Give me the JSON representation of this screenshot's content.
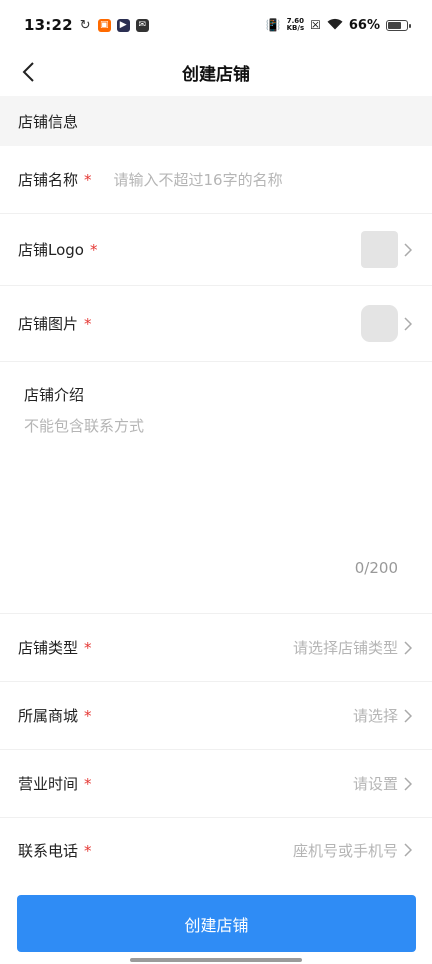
{
  "status": {
    "time": "13:22",
    "net_speed_top": "7.60",
    "net_speed_bottom": "KB/s",
    "battery": "66%",
    "battery_level": 0.66
  },
  "nav": {
    "title": "创建店铺"
  },
  "section": {
    "title": "店铺信息"
  },
  "form": {
    "required_mark": "*",
    "name": {
      "label": "店铺名称",
      "placeholder": "请输入不超过16字的名称",
      "value": ""
    },
    "logo": {
      "label": "店铺Logo"
    },
    "image": {
      "label": "店铺图片"
    },
    "intro": {
      "label": "店铺介绍",
      "placeholder": "不能包含联系方式",
      "counter": "0/200"
    },
    "type": {
      "label": "店铺类型",
      "placeholder": "请选择店铺类型"
    },
    "mall": {
      "label": "所属商城",
      "placeholder": "请选择"
    },
    "hours": {
      "label": "营业时间",
      "placeholder": "请设置"
    },
    "phone": {
      "label": "联系电话",
      "placeholder": "座机号或手机号"
    }
  },
  "submit": {
    "label": "创建店铺"
  },
  "colors": {
    "primary": "#2f8cf5",
    "required": "#e53935",
    "placeholder": "#b5b5b5"
  }
}
